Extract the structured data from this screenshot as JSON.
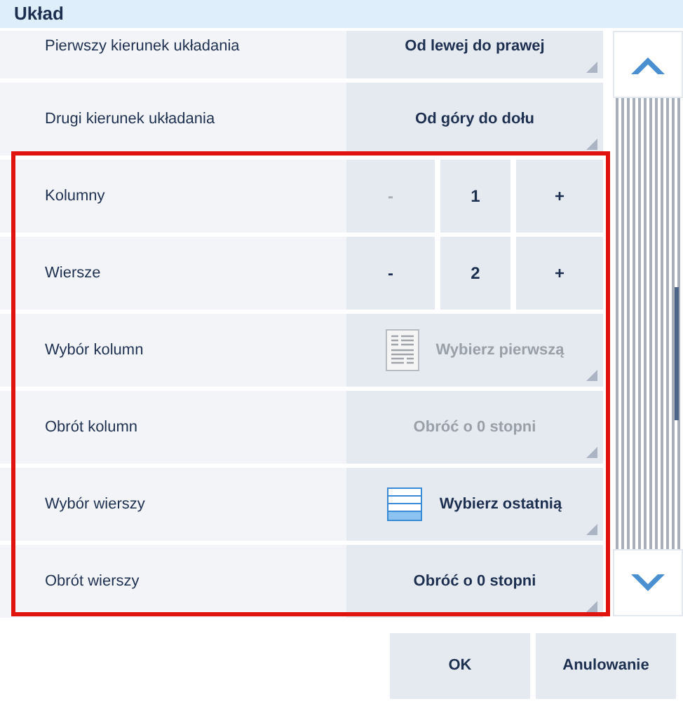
{
  "window": {
    "title": "Układ"
  },
  "settings": [
    {
      "kind": "dropdown",
      "label": "Pierwszy kierunek układania",
      "value": "Od lewej do prawej",
      "disabled": false
    },
    {
      "kind": "dropdown",
      "label": "Drugi kierunek układania",
      "value": "Od góry do dołu",
      "disabled": false
    }
  ],
  "highlighted_settings": [
    {
      "kind": "stepper",
      "label": "Kolumny",
      "minus": "-",
      "minus_disabled": true,
      "value": "1",
      "plus": "+"
    },
    {
      "kind": "stepper",
      "label": "Wiersze",
      "minus": "-",
      "minus_disabled": false,
      "value": "2",
      "plus": "+"
    },
    {
      "kind": "dropdown",
      "label": "Wybór kolumn",
      "value": "Wybierz pierwszą",
      "disabled": true
    },
    {
      "kind": "dropdown",
      "label": "Obrót kolumn",
      "value": "Obróć o 0 stopni",
      "disabled": true
    },
    {
      "kind": "dropdown",
      "label": "Wybór wierszy",
      "value": "Wybierz ostatnią",
      "disabled": false
    },
    {
      "kind": "dropdown",
      "label": "Obrót wierszy",
      "value": "Obróć o 0 stopni",
      "disabled": false
    }
  ],
  "buttons": [
    "OK",
    "Anulowanie"
  ]
}
